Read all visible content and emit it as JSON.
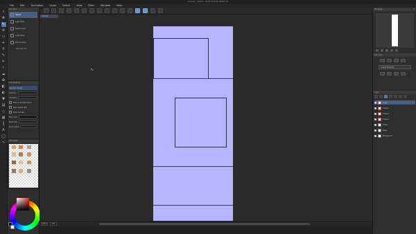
{
  "window": {
    "title": "Canvas - 100% - CLIP STUDIO PAINT EX"
  },
  "menu": {
    "items": [
      "File",
      "Edit",
      "Animation",
      "Layer",
      "Select",
      "View",
      "Filter",
      "Window",
      "Help"
    ]
  },
  "document_tab": {
    "label": "Canvas"
  },
  "tools": [
    {
      "name": "zoom-icon",
      "glyph": "⌕",
      "selected": false
    },
    {
      "name": "move-icon",
      "glyph": "✥",
      "selected": false
    },
    {
      "name": "operation-icon",
      "glyph": "↖",
      "selected": true
    },
    {
      "name": "move-layer-icon",
      "glyph": "✣",
      "selected": false
    },
    {
      "name": "selection-icon",
      "glyph": "▭",
      "selected": false
    },
    {
      "name": "auto-select-icon",
      "glyph": "✦",
      "selected": false
    },
    {
      "name": "eyedropper-icon",
      "glyph": "⚲",
      "selected": false
    },
    {
      "name": "pen-icon",
      "glyph": "✎",
      "selected": false
    },
    {
      "name": "pencil-icon",
      "glyph": "✏",
      "selected": false
    },
    {
      "name": "brush-icon",
      "glyph": "⌇",
      "selected": false
    },
    {
      "name": "airbrush-icon",
      "glyph": "☁",
      "selected": false
    },
    {
      "name": "decoration-icon",
      "glyph": "✿",
      "selected": false
    },
    {
      "name": "eraser-icon",
      "glyph": "◧",
      "selected": false
    },
    {
      "name": "blend-icon",
      "glyph": "◐",
      "selected": false
    },
    {
      "name": "fill-icon",
      "glyph": "▼",
      "selected": false
    },
    {
      "name": "gradient-icon",
      "glyph": "▤",
      "selected": false
    },
    {
      "name": "figure-icon",
      "glyph": "◇",
      "selected": false
    },
    {
      "name": "frame-border-icon",
      "glyph": "▦",
      "selected": false
    },
    {
      "name": "ruler-icon",
      "glyph": "┃",
      "selected": false
    },
    {
      "name": "text-icon",
      "glyph": "A",
      "selected": false
    },
    {
      "name": "balloon-icon",
      "glyph": "◯",
      "selected": false
    },
    {
      "name": "correct-line-icon",
      "glyph": "〜",
      "selected": false
    }
  ],
  "subtool": {
    "header": "Sub Tool",
    "items": [
      {
        "label": "Object",
        "selected": true
      },
      {
        "label": "Light table",
        "selected": false
      },
      {
        "label": "Select layer",
        "selected": false
      },
      {
        "label": "Light table",
        "selected": false
      },
      {
        "label": "Edit timeline",
        "selected": false
      }
    ],
    "add_label": "Add sub tool"
  },
  "tool_property": {
    "header": "Tool Property",
    "rows": [
      {
        "label": "Operation target",
        "type": "text",
        "highlight": true
      },
      {
        "label": "Selection",
        "type": "field"
      },
      {
        "label": "Transform",
        "type": "field"
      },
      {
        "label": "Show in transformation",
        "type": "check"
      },
      {
        "label": "Keep aspect ratio",
        "type": "check"
      },
      {
        "label": "Show handles",
        "type": "check"
      },
      {
        "label": "Main color",
        "type": "black"
      },
      {
        "label": "Brush size",
        "type": "field"
      },
      {
        "label": "Brush shape",
        "type": "field"
      }
    ]
  },
  "navigator_left": {
    "header": "Item bank"
  },
  "status": {
    "zoom": "100.0",
    "angle": "0.0"
  },
  "right_panels": {
    "navigator_header": "Navigator",
    "subview_header": "Sub View",
    "subview_rows": [
      "Layer Property"
    ],
    "layers_header": "Layer",
    "layers": [
      {
        "name": "Layer",
        "selected": true,
        "thumb": "plain"
      },
      {
        "name": "Frame 1",
        "selected": false,
        "thumb": "red"
      },
      {
        "name": "Frame 2",
        "selected": false,
        "thumb": "red"
      },
      {
        "name": "Frame 3",
        "selected": false,
        "thumb": "red"
      },
      {
        "name": "Folder",
        "selected": false,
        "thumb": "plain"
      },
      {
        "name": "Paper",
        "selected": false,
        "thumb": "plain"
      },
      {
        "name": "Background",
        "selected": false,
        "thumb": "plain"
      }
    ]
  },
  "colors": {
    "canvas_page": "#b4b4ff",
    "accent": "#5a77a8",
    "main_color": "#000000",
    "sub_color": "#ffffff"
  }
}
